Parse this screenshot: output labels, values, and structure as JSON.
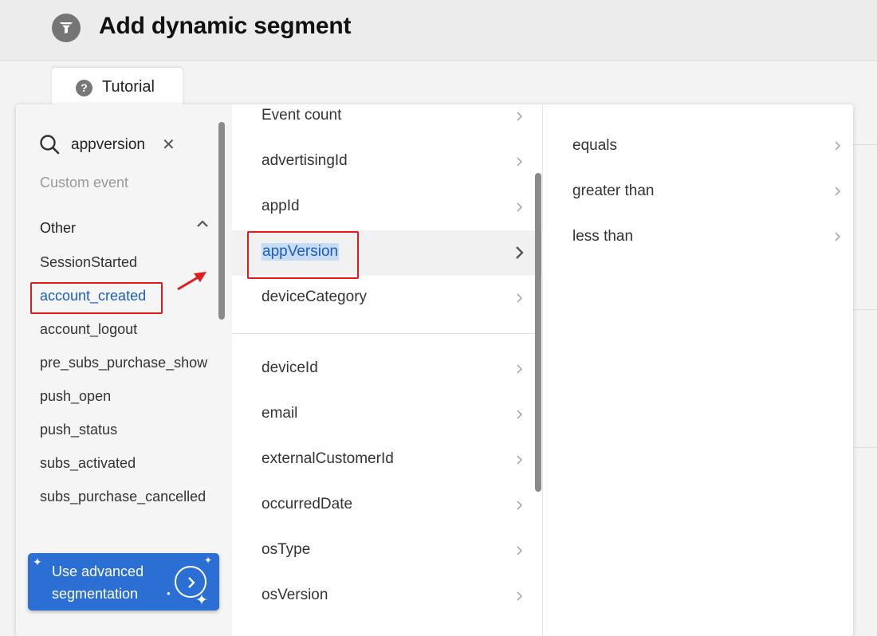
{
  "header": {
    "title": "Add dynamic segment",
    "icon": "filter-icon"
  },
  "tutorial_tab": {
    "label": "Tutorial",
    "icon": "question-icon"
  },
  "colors": {
    "accent": "#2b6fd4",
    "selected_text": "#1a5dc2",
    "annotation": "#e01b1b"
  },
  "event_column": {
    "search_value": "appversion",
    "custom_event_label": "Custom event",
    "group_title": "Other",
    "events": [
      "SessionStarted",
      "account_created",
      "account_logout",
      "pre_subs_purchase_show",
      "push_open",
      "push_status",
      "subs_activated",
      "subs_purchase_cancelled"
    ],
    "selected_event": "account_created",
    "advanced_button_label": "Use advanced segmentation"
  },
  "attribute_column": {
    "items": [
      "Event count",
      "advertisingId",
      "appId",
      "appVersion",
      "deviceCategory",
      "deviceId",
      "email",
      "externalCustomerId",
      "occurredDate",
      "osType",
      "osVersion"
    ],
    "selected_item": "appVersion"
  },
  "operator_column": {
    "items": [
      "equals",
      "greater than",
      "less than"
    ]
  }
}
